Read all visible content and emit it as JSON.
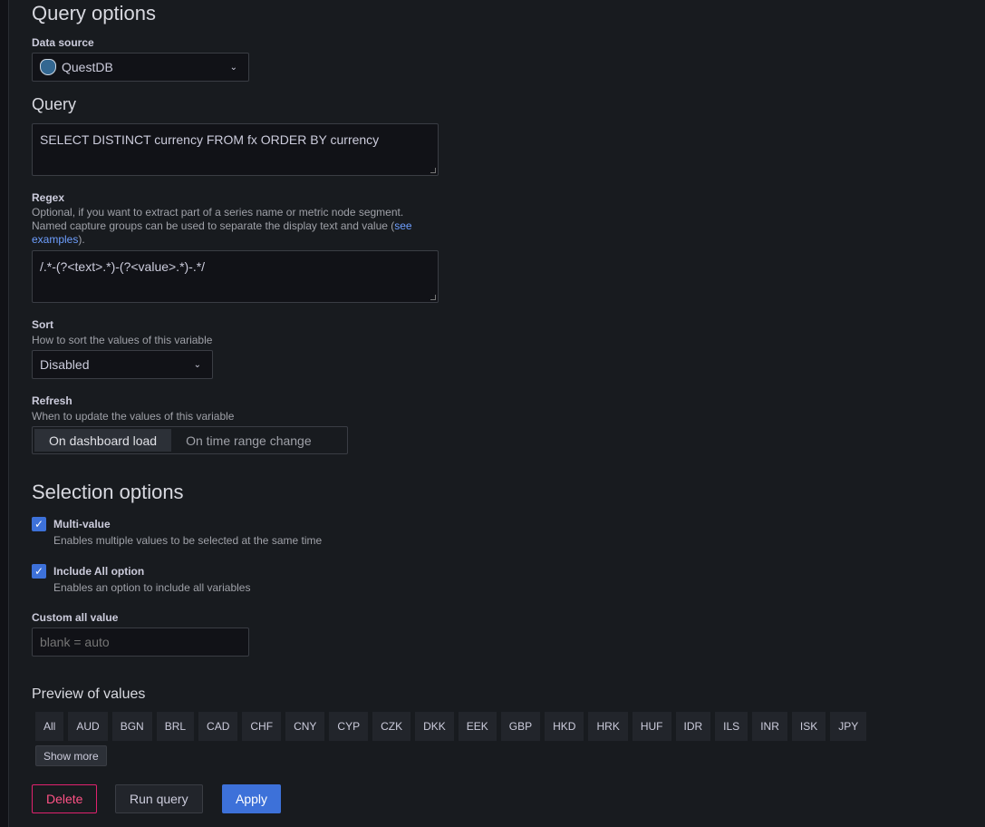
{
  "query_options": {
    "title": "Query options",
    "data_source_label": "Data source",
    "data_source": "QuestDB",
    "data_source_icon": "postgres-elephant-icon",
    "query_title": "Query",
    "query": "SELECT DISTINCT currency FROM fx ORDER BY currency"
  },
  "regex": {
    "label": "Regex",
    "desc1": "Optional, if you want to extract part of a series name or metric node segment.",
    "desc2": "Named capture groups can be used to separate the display text and value (",
    "link": "see examples",
    "desc_end": ").",
    "value": "/.*-(?<text>.*)-(?<value>.*)-.*/"
  },
  "sort": {
    "label": "Sort",
    "desc": "How to sort the values of this variable",
    "value": "Disabled"
  },
  "refresh": {
    "label": "Refresh",
    "desc": "When to update the values of this variable",
    "options": [
      "On dashboard load",
      "On time range change"
    ],
    "selected": "On dashboard load"
  },
  "selection": {
    "title": "Selection options",
    "multi_label": "Multi-value",
    "multi_desc": "Enables multiple values to be selected at the same time",
    "multi_checked": true,
    "all_label": "Include All option",
    "all_desc": "Enables an option to include all variables",
    "all_checked": true,
    "custom_label": "Custom all value",
    "custom_placeholder": "blank = auto"
  },
  "preview": {
    "title": "Preview of values",
    "values": [
      "All",
      "AUD",
      "BGN",
      "BRL",
      "CAD",
      "CHF",
      "CNY",
      "CYP",
      "CZK",
      "DKK",
      "EEK",
      "GBP",
      "HKD",
      "HRK",
      "HUF",
      "IDR",
      "ILS",
      "INR",
      "ISK",
      "JPY"
    ],
    "show_more": "Show more"
  },
  "actions": {
    "delete": "Delete",
    "run": "Run query",
    "apply": "Apply"
  },
  "colors": {
    "accent": "#3d71d9",
    "danger": "#e0226e",
    "background": "#181b1f"
  }
}
